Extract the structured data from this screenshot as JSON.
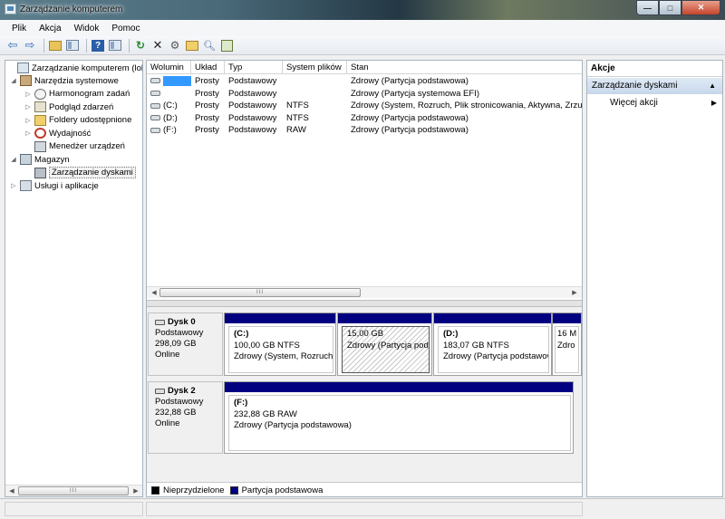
{
  "window": {
    "title": "Zarządzanie komputerem"
  },
  "menu": [
    "Plik",
    "Akcja",
    "Widok",
    "Pomoc"
  ],
  "toolbar_icons": [
    "back-arrow-icon",
    "forward-arrow-icon",
    "up-folder-icon",
    "show-hide-tree-icon",
    "help-icon",
    "show-hide-action-pane-icon",
    "refresh-icon",
    "delete-icon",
    "properties-icon",
    "open-folder-icon",
    "search-icon",
    "export-icon"
  ],
  "tree": [
    {
      "label": "Zarządzanie komputerem (loka",
      "icon": "computer-icon",
      "twisty": ""
    },
    {
      "label": "Narzędzia systemowe",
      "icon": "tools-icon",
      "twisty": "◢"
    },
    {
      "label": "Harmonogram zadań",
      "icon": "clock-icon",
      "twisty": "▷"
    },
    {
      "label": "Podgląd zdarzeń",
      "icon": "event-viewer-icon",
      "twisty": "▷"
    },
    {
      "label": "Foldery udostępnione",
      "icon": "shared-folder-icon",
      "twisty": "▷"
    },
    {
      "label": "Wydajność",
      "icon": "performance-icon",
      "twisty": "▷"
    },
    {
      "label": "Menedżer urządzeń",
      "icon": "device-manager-icon",
      "twisty": ""
    },
    {
      "label": "Magazyn",
      "icon": "storage-icon",
      "twisty": "◢"
    },
    {
      "label": "Zarządzanie dyskami",
      "icon": "disk-management-icon",
      "twisty": ""
    },
    {
      "label": "Usługi i aplikacje",
      "icon": "services-icon",
      "twisty": "▷"
    }
  ],
  "volume_list": {
    "columns": [
      "Wolumin",
      "Układ",
      "Typ",
      "System plików",
      "Stan"
    ],
    "rows": [
      {
        "volume": "",
        "layout": "Prosty",
        "type": "Podstawowy",
        "fs": "",
        "status": "Zdrowy (Partycja podstawowa)"
      },
      {
        "volume": "",
        "layout": "Prosty",
        "type": "Podstawowy",
        "fs": "",
        "status": "Zdrowy (Partycja systemowa EFI)"
      },
      {
        "volume": "(C:)",
        "layout": "Prosty",
        "type": "Podstawowy",
        "fs": "NTFS",
        "status": "Zdrowy (System, Rozruch, Plik stronicowania, Aktywna, Zrzu"
      },
      {
        "volume": "(D:)",
        "layout": "Prosty",
        "type": "Podstawowy",
        "fs": "NTFS",
        "status": "Zdrowy (Partycja podstawowa)"
      },
      {
        "volume": "(F:)",
        "layout": "Prosty",
        "type": "Podstawowy",
        "fs": "RAW",
        "status": "Zdrowy (Partycja podstawowa)"
      }
    ],
    "scroll_thumb": "III"
  },
  "disks": [
    {
      "name": "Dysk 0",
      "kind": "Podstawowy",
      "size": "298,09 GB",
      "state": "Online",
      "partitions": [
        {
          "drive": "(C:)",
          "size": "100,00 GB NTFS",
          "status": "Zdrowy (System, Rozruch,"
        },
        {
          "drive": "",
          "size": "15,00 GB",
          "status": "Zdrowy (Partycja pod"
        },
        {
          "drive": "(D:)",
          "size": "183,07 GB NTFS",
          "status": "Zdrowy (Partycja podstawow"
        },
        {
          "drive": "",
          "size": "16 M",
          "status": "Zdro"
        }
      ]
    },
    {
      "name": "Dysk 2",
      "kind": "Podstawowy",
      "size": "232,88 GB",
      "state": "Online",
      "partitions": [
        {
          "drive": "(F:)",
          "size": "232,88 GB RAW",
          "status": "Zdrowy (Partycja podstawowa)"
        }
      ]
    }
  ],
  "legend": {
    "unallocated": "Nieprzydzielone",
    "primary": "Partycja podstawowa"
  },
  "left_scroll_thumb": "III",
  "actions": {
    "title": "Akcje",
    "section": "Zarządzanie dyskami",
    "more": "Więcej akcji"
  },
  "colors": {
    "primary_partition": "#000080",
    "selection": "#3399ff",
    "unallocated": "#000000"
  }
}
